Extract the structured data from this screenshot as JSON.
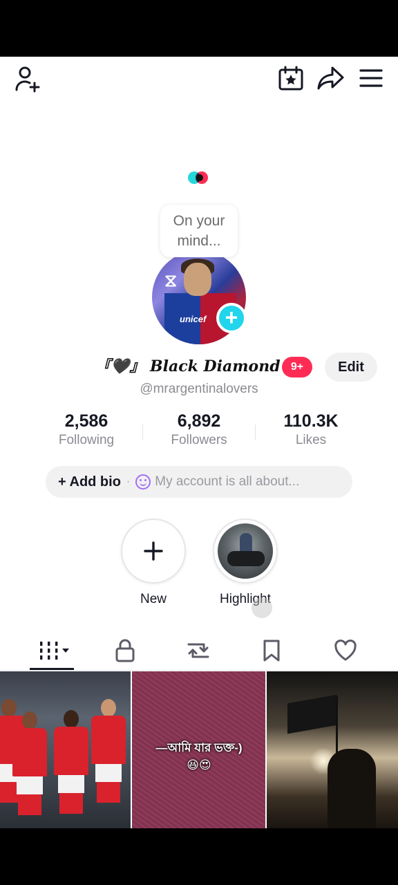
{
  "header": {
    "add_friend_icon": "person-add-icon",
    "calendar_icon": "calendar-star-icon",
    "share_icon": "share-arrow-icon",
    "menu_icon": "hamburger-menu-icon"
  },
  "profile": {
    "thought_bubble": "On your\nmind...",
    "display_name": "『🖤』 Black Diamond",
    "badge": "9+",
    "edit_label": "Edit",
    "handle": "@mrargentinalovers"
  },
  "stats": [
    {
      "value": "2,586",
      "label": "Following"
    },
    {
      "value": "6,892",
      "label": "Followers"
    },
    {
      "value": "110.3K",
      "label": "Likes"
    }
  ],
  "bio": {
    "add_label": "+ Add bio",
    "separator": "·",
    "placeholder": "My account is all about..."
  },
  "highlights": [
    {
      "label": "New"
    },
    {
      "label": "Highlight"
    }
  ],
  "tabs": [
    {
      "icon": "videos-grid-icon"
    },
    {
      "icon": "lock-icon"
    },
    {
      "icon": "repost-icon"
    },
    {
      "icon": "bookmark-icon"
    },
    {
      "icon": "heart-icon"
    }
  ],
  "videos": [
    {
      "caption": ""
    },
    {
      "caption": "—আমি যার ভক্ত-)\n😆😍"
    },
    {
      "caption": ""
    }
  ],
  "colors": {
    "accent_pink": "#fe2c55",
    "accent_cyan": "#20d5ec",
    "text_dark": "#161823",
    "text_muted": "#8a8b91"
  }
}
